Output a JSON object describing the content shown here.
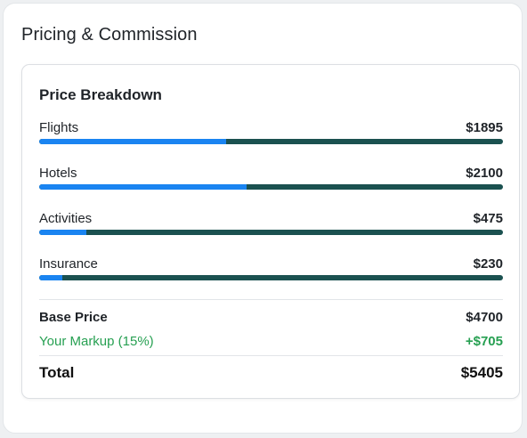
{
  "panel": {
    "title": "Pricing & Commission"
  },
  "breakdown": {
    "title": "Price Breakdown",
    "items": [
      {
        "label": "Flights",
        "amount": "$1895",
        "share": 0.403
      },
      {
        "label": "Hotels",
        "amount": "$2100",
        "share": 0.447
      },
      {
        "label": "Activities",
        "amount": "$475",
        "share": 0.101
      },
      {
        "label": "Insurance",
        "amount": "$230",
        "share": 0.049
      }
    ],
    "bar_fill_color": "#1a84f1",
    "bar_track_color": "#1b5150"
  },
  "summary": {
    "base_label": "Base Price",
    "base_value": "$4700",
    "markup_label": "Your Markup (15%)",
    "markup_value": "+$705",
    "markup_color": "#27a052",
    "total_label": "Total",
    "total_value": "$5405"
  }
}
